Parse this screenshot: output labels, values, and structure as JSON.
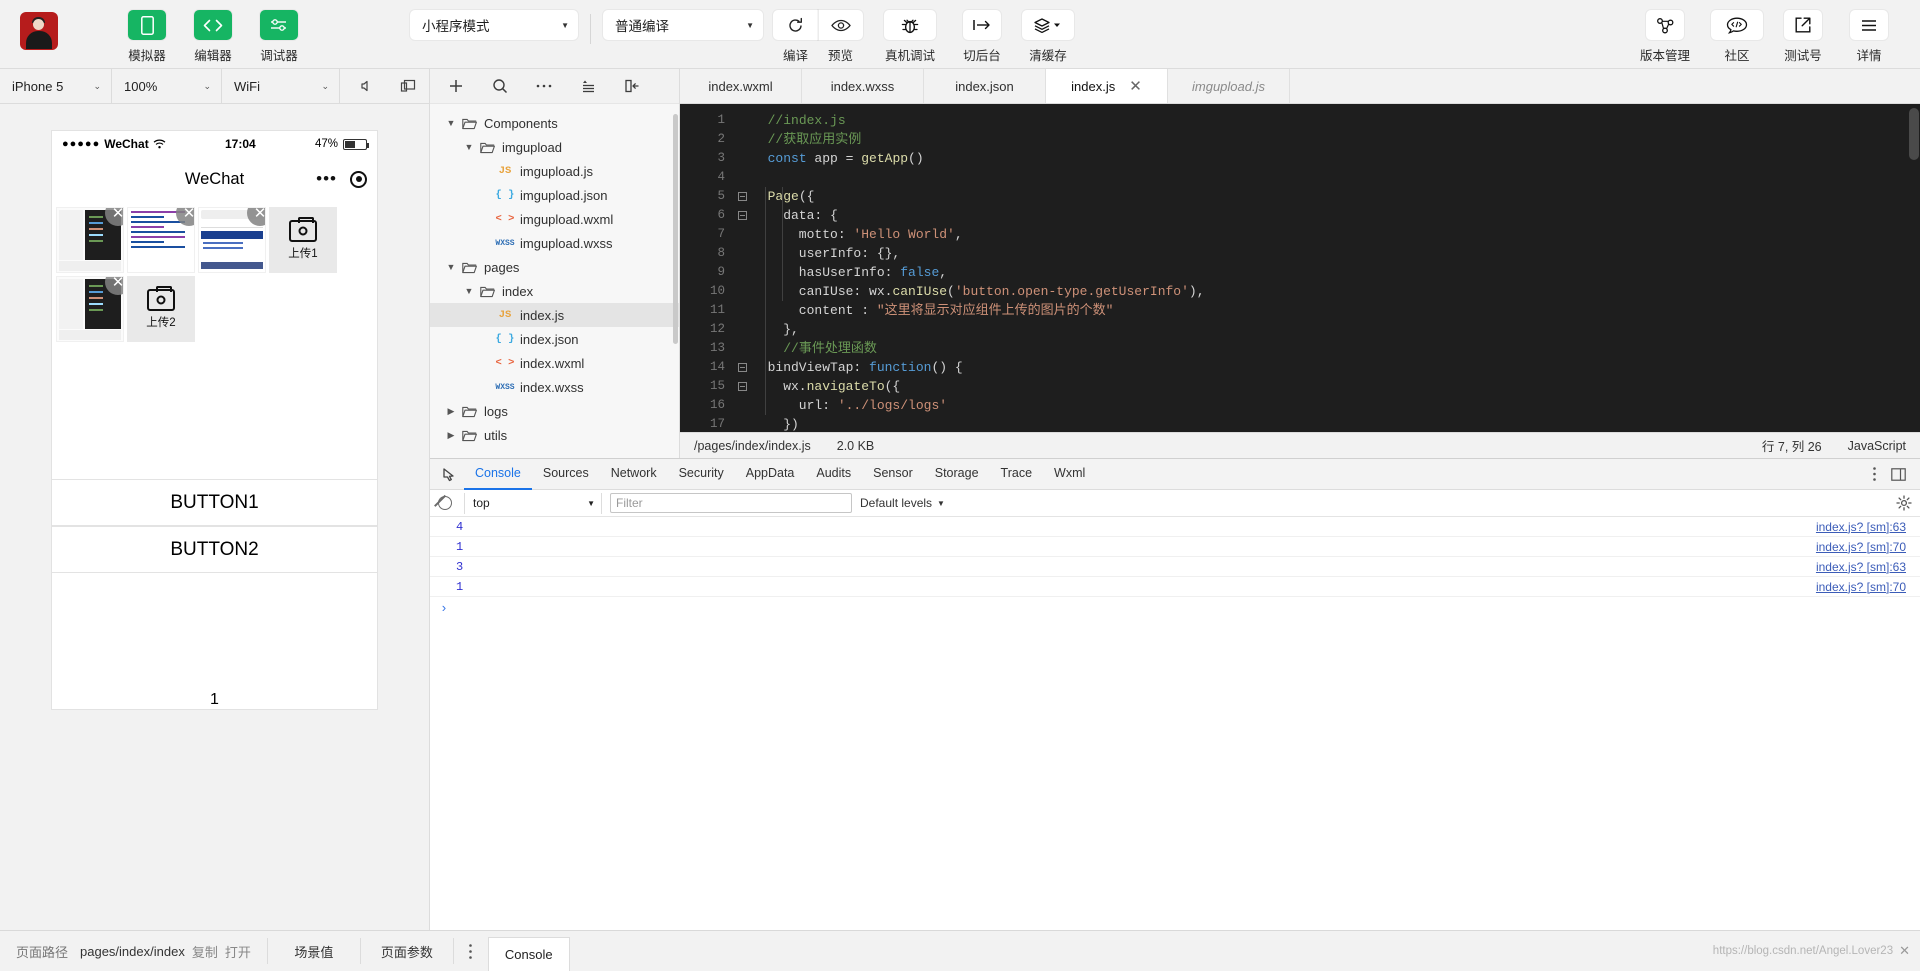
{
  "toolbar": {
    "left_items": [
      {
        "label": "模拟器",
        "icon": "phone-icon"
      },
      {
        "label": "编辑器",
        "icon": "code-icon"
      },
      {
        "label": "调试器",
        "icon": "debug-slider-icon"
      }
    ],
    "mode_select": {
      "value": "小程序模式",
      "icon": "chevron-down-icon"
    },
    "compile_select": {
      "value": "普通编译",
      "icon": "chevron-down-icon"
    },
    "compile_label": "编译",
    "preview_label": "预览",
    "compile_icon": "refresh-icon",
    "preview_icon": "eye-icon",
    "remote_debug": {
      "label": "真机调试",
      "icon": "bug-icon"
    },
    "switch_back": {
      "label": "切后台",
      "icon": "arrow-to-line-icon"
    },
    "clear_cache": {
      "label": "清缓存",
      "icon": "layers-icon"
    },
    "right_items": [
      {
        "label": "版本管理",
        "icon": "git-branch-icon"
      },
      {
        "label": "社区",
        "icon": "chat-code-icon"
      },
      {
        "label": "测试号",
        "icon": "external-link-icon"
      },
      {
        "label": "详情",
        "icon": "hamburger-icon"
      }
    ]
  },
  "simulator": {
    "device": "iPhone 5",
    "zoom": "100%",
    "network": "WiFi",
    "icons": [
      "mute-icon",
      "rotate-screen-icon"
    ],
    "phone": {
      "carrier": "WeChat",
      "signal_dots": "●●●●●",
      "wifi_icon": "wifi-icon",
      "time": "17:04",
      "battery": "47%",
      "nav_title": "WeChat",
      "capsule_dots": "•••",
      "upload_buttons": [
        "上传1",
        "上传2"
      ],
      "buttons": [
        "BUTTON1",
        "BUTTON2"
      ],
      "count": "1"
    }
  },
  "tree_head_icons": [
    "plus-icon",
    "search-icon",
    "more-icon",
    "collapse-icon",
    "split-icon"
  ],
  "file_tree": [
    {
      "depth": 0,
      "label": "Components",
      "type": "folder",
      "expanded": true,
      "selected": false
    },
    {
      "depth": 1,
      "label": "imgupload",
      "type": "folder",
      "expanded": true,
      "selected": false
    },
    {
      "depth": 2,
      "label": "imgupload.js",
      "type": "js",
      "selected": false
    },
    {
      "depth": 2,
      "label": "imgupload.json",
      "type": "json",
      "selected": false
    },
    {
      "depth": 2,
      "label": "imgupload.wxml",
      "type": "wxml",
      "selected": false
    },
    {
      "depth": 2,
      "label": "imgupload.wxss",
      "type": "wxss",
      "selected": false
    },
    {
      "depth": 0,
      "label": "pages",
      "type": "folder",
      "expanded": true,
      "selected": false
    },
    {
      "depth": 1,
      "label": "index",
      "type": "folder",
      "expanded": true,
      "selected": false
    },
    {
      "depth": 2,
      "label": "index.js",
      "type": "js",
      "selected": true
    },
    {
      "depth": 2,
      "label": "index.json",
      "type": "json",
      "selected": false
    },
    {
      "depth": 2,
      "label": "index.wxml",
      "type": "wxml",
      "selected": false
    },
    {
      "depth": 2,
      "label": "index.wxss",
      "type": "wxss",
      "selected": false
    },
    {
      "depth": 0,
      "label": "logs",
      "type": "folder",
      "expanded": false,
      "selected": false
    },
    {
      "depth": 0,
      "label": "utils",
      "type": "folder",
      "expanded": false,
      "selected": false
    }
  ],
  "editor": {
    "tabs": [
      {
        "label": "index.wxml",
        "active": false,
        "italic": false,
        "closable": false
      },
      {
        "label": "index.wxss",
        "active": false,
        "italic": false,
        "closable": false
      },
      {
        "label": "index.json",
        "active": false,
        "italic": false,
        "closable": false
      },
      {
        "label": "index.js",
        "active": true,
        "italic": false,
        "closable": true
      },
      {
        "label": "imgupload.js",
        "active": false,
        "italic": true,
        "closable": false
      }
    ],
    "close_icon": "close-icon",
    "lines": [
      {
        "n": "1",
        "fold": false,
        "html": "  <span class='cmt'>//index.js</span>"
      },
      {
        "n": "2",
        "fold": false,
        "html": "  <span class='cmt'>//获取应用实例</span>"
      },
      {
        "n": "3",
        "fold": false,
        "html": "  <span class='kw'>const</span> app = <span class='fn'>getApp</span>()"
      },
      {
        "n": "4",
        "fold": false,
        "html": ""
      },
      {
        "n": "5",
        "fold": true,
        "html": "  <span class='fn'>Page</span>({"
      },
      {
        "n": "6",
        "fold": true,
        "html": "    data: {"
      },
      {
        "n": "7",
        "fold": false,
        "html": "      motto: <span class='str'>'Hello World'</span>,"
      },
      {
        "n": "8",
        "fold": false,
        "html": "      userInfo: {},"
      },
      {
        "n": "9",
        "fold": false,
        "html": "      hasUserInfo: <span class='lit'>false</span>,"
      },
      {
        "n": "10",
        "fold": false,
        "html": "      canIUse: wx.<span class='fn'>canIUse</span>(<span class='str'>'button.open-type.getUserInfo'</span>),"
      },
      {
        "n": "11",
        "fold": false,
        "html": "      content : <span class='str'>\"这里将显示对应组件上传的图片的个数\"</span>"
      },
      {
        "n": "12",
        "fold": false,
        "html": "    },"
      },
      {
        "n": "13",
        "fold": false,
        "html": "    <span class='cmt'>//事件处理函数</span>"
      },
      {
        "n": "14",
        "fold": true,
        "html": "  bindViewTap: <span class='kw'>function</span>() {"
      },
      {
        "n": "15",
        "fold": true,
        "html": "    wx.<span class='fn'>navigateTo</span>({"
      },
      {
        "n": "16",
        "fold": false,
        "html": "      url: <span class='str'>'../logs/logs'</span>"
      },
      {
        "n": "17",
        "fold": false,
        "html": "    })"
      }
    ],
    "status": {
      "path": "/pages/index/index.js",
      "size": "2.0 KB",
      "cursor": "行 7, 列 26",
      "language": "JavaScript"
    }
  },
  "devtools": {
    "inspect_icon": "inspect-icon",
    "tabs": [
      {
        "label": "Console",
        "active": true
      },
      {
        "label": "Sources",
        "active": false
      },
      {
        "label": "Network",
        "active": false
      },
      {
        "label": "Security",
        "active": false
      },
      {
        "label": "AppData",
        "active": false
      },
      {
        "label": "Audits",
        "active": false
      },
      {
        "label": "Sensor",
        "active": false
      },
      {
        "label": "Storage",
        "active": false
      },
      {
        "label": "Trace",
        "active": false
      },
      {
        "label": "Wxml",
        "active": false
      }
    ],
    "right_icons": [
      "kebab-menu-icon",
      "dock-icon"
    ],
    "filter_bar": {
      "clear_icon": "clear-console-icon",
      "context": "top",
      "filter_placeholder": "Filter",
      "levels": "Default levels",
      "gear_icon": "gear-icon"
    },
    "messages": [
      {
        "value": "4",
        "source": "index.js? [sm]:63"
      },
      {
        "value": "1",
        "source": "index.js? [sm]:70"
      },
      {
        "value": "3",
        "source": "index.js? [sm]:63"
      },
      {
        "value": "1",
        "source": "index.js? [sm]:70"
      }
    ],
    "prompt": "›"
  },
  "bottom_bar": {
    "path_label": "页面路径",
    "path_value": "pages/index/index",
    "copy_label": "复制",
    "open_label": "打开",
    "scene_label": "场景值",
    "params_label": "页面参数",
    "dots_icon": "kebab-menu-icon",
    "console_chip": "Console",
    "watermark": "https://blog.csdn.net/Angel.Lover23",
    "watermark_close": "✕"
  }
}
